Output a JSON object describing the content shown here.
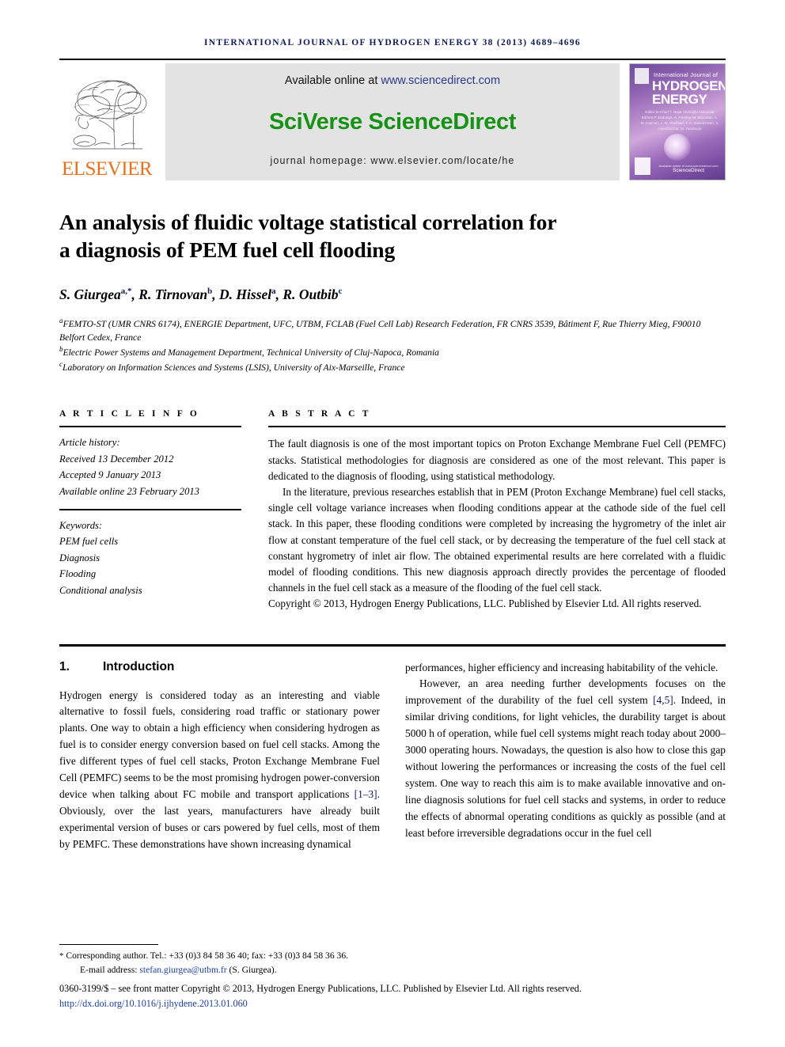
{
  "running_head": "INTERNATIONAL JOURNAL OF HYDROGEN ENERGY 38 (2013) 4689–4696",
  "masthead": {
    "publisher_name": "ELSEVIER",
    "available_online_prefix": "Available online at ",
    "available_online_url": "www.sciencedirect.com",
    "wordmark": "SciVerse ScienceDirect",
    "journal_homepage": "journal homepage: www.elsevier.com/locate/he",
    "cover": {
      "line_small": "International Journal of",
      "line1": "HYDROGEN",
      "line2": "ENERGY",
      "editors": "Editor-in-Chief  T. Nejat Veziroğlu\nAssociate Editors  P. Ekdunge, A. Pandey, M. Momirlan, A. M. Kannan, J. W. Sheffield, T. A. Zawodzinski, V. Ananthachar, M. Yorukoglu",
      "sciencedirect_label": "ScienceDirect",
      "sciencedirect_sub": "Available online at www.sciencedirect.com"
    }
  },
  "article": {
    "title_line1": "An analysis of fluidic voltage statistical correlation for",
    "title_line2": "a diagnosis of PEM fuel cell flooding",
    "authors": [
      {
        "name": "S. Giurgea",
        "sup": "a,*"
      },
      {
        "name": "R. Tirnovan",
        "sup": "b"
      },
      {
        "name": "D. Hissel",
        "sup": "a"
      },
      {
        "name": "R. Outbib",
        "sup": "c"
      }
    ],
    "affiliations": [
      {
        "sup": "a",
        "text": "FEMTO-ST (UMR CNRS 6174), ENERGIE Department, UFC, UTBM, FCLAB (Fuel Cell Lab) Research Federation, FR CNRS 3539, Bâtiment F, Rue Thierry Mieg, F90010 Belfort Cedex, France"
      },
      {
        "sup": "b",
        "text": "Electric Power Systems and Management Department, Technical University of Cluj-Napoca, Romania"
      },
      {
        "sup": "c",
        "text": "Laboratory on Information Sciences and Systems (LSIS), University of Aix-Marseille, France"
      }
    ]
  },
  "article_info": {
    "heading": "A R T I C L E   I N F O",
    "history_label": "Article history:",
    "received": "Received 13 December 2012",
    "accepted": "Accepted 9 January 2013",
    "available_online": "Available online 23 February 2013",
    "keywords_label": "Keywords:",
    "keywords": [
      "PEM fuel cells",
      "Diagnosis",
      "Flooding",
      "Conditional analysis"
    ]
  },
  "abstract": {
    "heading": "A B S T R A C T",
    "paragraph1": "The fault diagnosis is one of the most important topics on Proton Exchange Membrane Fuel Cell (PEMFC) stacks. Statistical methodologies for diagnosis are considered as one of the most relevant. This paper is dedicated to the diagnosis of flooding, using statistical methodology.",
    "paragraph2": "In the literature, previous researches establish that in PEM (Proton Exchange Membrane) fuel cell stacks, single cell voltage variance increases when flooding conditions appear at the cathode side of the fuel cell stack. In this paper, these flooding conditions were completed by increasing the hygrometry of the inlet air flow at constant temperature of the fuel cell stack, or by decreasing the temperature of the fuel cell stack at constant hygrometry of inlet air flow. The obtained experimental results are here correlated with a fluidic model of flooding conditions. This new diagnosis approach directly provides the percentage of flooded channels in the fuel cell stack as a measure of the flooding of the fuel cell stack.",
    "copyright": "Copyright © 2013, Hydrogen Energy Publications, LLC. Published by Elsevier Ltd. All rights reserved."
  },
  "body": {
    "section_number": "1.",
    "section_title": "Introduction",
    "left_paragraph": "Hydrogen energy is considered today as an interesting and viable alternative to fossil fuels, considering road traffic or stationary power plants. One way to obtain a high efficiency when considering hydrogen as fuel is to consider energy conversion based on fuel cell stacks. Among the five different types of fuel cell stacks, Proton Exchange Membrane Fuel Cell (PEMFC) seems to be the most promising hydrogen power-conversion device when talking about FC mobile and transport applications ",
    "left_ref": "[1–3]",
    "left_paragraph_cont": ". Obviously, over the last years, manufacturers have already built experimental version of buses or cars powered by fuel cells, most of them by PEMFC. These demonstrations have shown increasing dynamical",
    "right_paragraph1": "performances, higher efficiency and increasing habitability of the vehicle.",
    "right_paragraph2_a": "However, an area needing further developments focuses on the improvement of the durability of the fuel cell system ",
    "right_ref": "[4,5]",
    "right_paragraph2_b": ". Indeed, in similar driving conditions, for light vehicles, the durability target is about 5000 h of operation, while fuel cell systems might reach today about 2000–3000 operating hours. Nowadays, the question is also how to close this gap without lowering the performances or increasing the costs of the fuel cell system. One way to reach this aim is to make available innovative and on-line diagnosis solutions for fuel cell stacks and systems, in order to reduce the effects of abnormal operating conditions as quickly as possible (and at least before irreversible degradations occur in the fuel cell"
  },
  "footer": {
    "corresponding_star": "*",
    "corresponding_author": "Corresponding author. Tel.: +33 (0)3 84 58 36 40; fax: +33 (0)3 84 58 36 36.",
    "email_label": "E-mail address: ",
    "email": "stefan.giurgea@utbm.fr",
    "email_suffix": " (S. Giurgea).",
    "issn_copyright": "0360-3199/$ – see front matter Copyright © 2013, Hydrogen Energy Publications, LLC. Published by Elsevier Ltd. All rights reserved.",
    "doi": "http://dx.doi.org/10.1016/j.ijhydene.2013.01.060"
  },
  "colors": {
    "running_head": "#0d1a5e",
    "elsevier_orange": "#E9711C",
    "sciencedirect_green": "#179116",
    "link_blue": "#1a3faa",
    "banner_gray": "#e3e3e3"
  }
}
